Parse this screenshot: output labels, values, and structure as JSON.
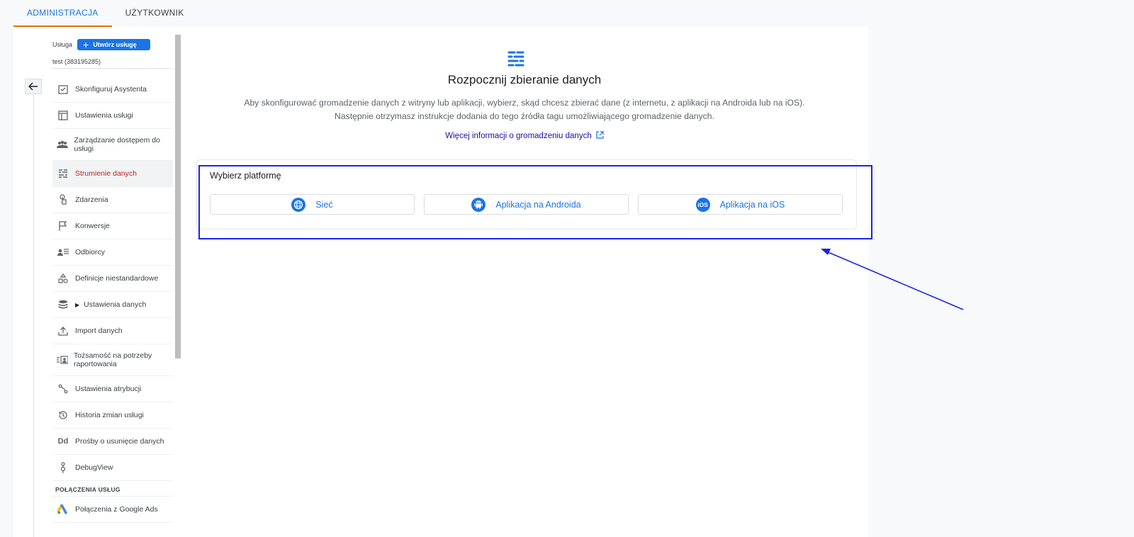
{
  "tabs": [
    {
      "label": "ADMINISTRACJA",
      "active": true
    },
    {
      "label": "UŻYTKOWNIK",
      "active": false
    }
  ],
  "sidebar": {
    "header_label": "Usługa",
    "create_button": "Utwórz usługę",
    "property_name": "test (383195285)",
    "items": [
      {
        "label": "Skonfiguruj Asystenta",
        "icon": "checklist-icon"
      },
      {
        "label": "Ustawienia usługi",
        "icon": "layout-icon"
      },
      {
        "label": "Zarządzanie dostępem do usługi",
        "icon": "people-icon"
      },
      {
        "label": "Strumienie danych",
        "icon": "streams-icon",
        "active": true
      },
      {
        "label": "Zdarzenia",
        "icon": "touch-icon"
      },
      {
        "label": "Konwersje",
        "icon": "flag-icon"
      },
      {
        "label": "Odbiorcy",
        "icon": "audience-icon"
      },
      {
        "label": "Definicje niestandardowe",
        "icon": "shapes-icon"
      },
      {
        "label": "Ustawienia danych",
        "icon": "database-icon",
        "expandable": true
      },
      {
        "label": "Import danych",
        "icon": "upload-icon"
      },
      {
        "label": "Tożsamość na potrzeby raportowania",
        "icon": "identity-icon"
      },
      {
        "label": "Ustawienia atrybucji",
        "icon": "attribution-icon"
      },
      {
        "label": "Historia zmian usługi",
        "icon": "history-icon"
      },
      {
        "label": "Prośby o usunięcie danych",
        "icon": "dd-icon"
      },
      {
        "label": "DebugView",
        "icon": "debug-icon"
      }
    ],
    "section_title": "POŁĄCZENIA USŁUG",
    "section_items": [
      {
        "label": "Połączenia z Google Ads",
        "icon": "google-ads-icon"
      }
    ]
  },
  "content": {
    "title": "Rozpocznij zbieranie danych",
    "description_line1": "Aby skonfigurować gromadzenie danych z witryny lub aplikacji, wybierz, skąd chcesz zbierać dane (z internetu, z aplikacji na Androida lub na iOS).",
    "description_line2": "Następnie otrzymasz instrukcje dodania do tego źródła tagu umożliwiającego gromadzenie danych.",
    "more_link": "Więcej informacji o gromadzeniu danych",
    "platform_title": "Wybierz platformę",
    "platforms": [
      {
        "label": "Sieć",
        "icon": "globe-icon"
      },
      {
        "label": "Aplikacja na Androida",
        "icon": "android-icon"
      },
      {
        "label": "Aplikacja na iOS",
        "icon": "ios-icon"
      }
    ]
  },
  "colors": {
    "accent": "#1a73e8",
    "active_nav": "#c5221f",
    "tab_underline": "#e8710a",
    "annotation": "#1a24e6"
  }
}
